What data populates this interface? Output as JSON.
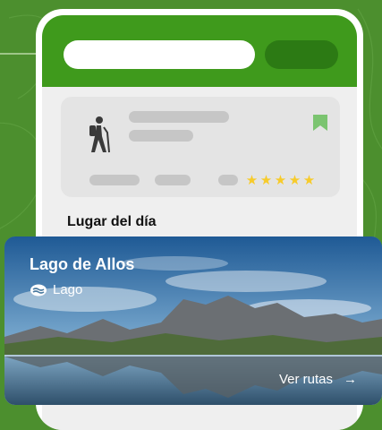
{
  "header": {
    "search_icon": "search-bar-blank",
    "action_icon": "header-action-blank"
  },
  "route_card": {
    "activity_icon": "hiker-icon",
    "bookmark_icon": "bookmark-icon",
    "rating_stars": 5,
    "colors": {
      "accent": "#3f9a1c",
      "bookmark": "#7bc470",
      "star": "#f7cb2a"
    }
  },
  "section": {
    "title": "Lugar del día"
  },
  "place": {
    "name": "Lago de Allos",
    "type_icon": "lake-icon",
    "type_label": "Lago",
    "cta_label": "Ver rutas",
    "cta_icon": "arrow-right-icon"
  }
}
